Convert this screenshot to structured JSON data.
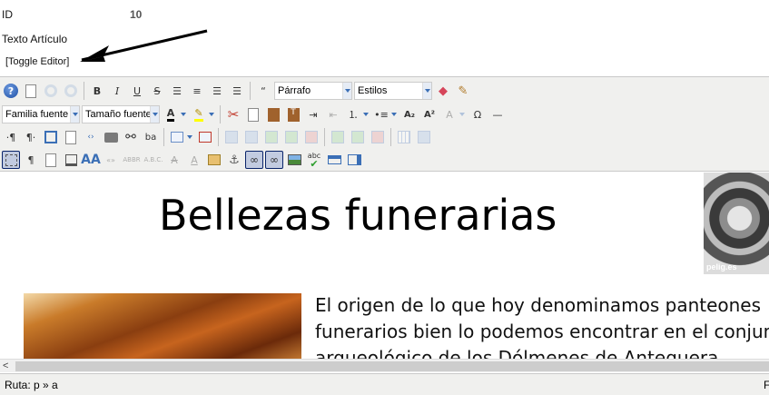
{
  "form": {
    "id_label": "ID",
    "id_value": "10",
    "text_label": "Texto Artículo",
    "toggle_editor": "[Toggle Editor]"
  },
  "toolbar": {
    "format_select": "Párrafo",
    "styles_select": "Estilos",
    "font_family_select": "Familia fuente",
    "font_size_select": "Tamaño fuente",
    "bold": "B",
    "italic": "I",
    "underline": "U",
    "strike": "S",
    "blockquote": "“",
    "subscript": "A₂",
    "superscript": "A²",
    "omega": "Ω",
    "abbr": "ABBR",
    "acronym": "A.B.C.",
    "cite": "«»",
    "spell": "abc"
  },
  "content": {
    "heading": "Bellezas funerarias",
    "image_watermark": "pelig.es",
    "paragraph_lines": [
      "El origen de lo que hoy denominamos panteones",
      "funerarios bien lo podemos encontrar en el conjun",
      "arqueológico de los Dólmenes de Antequera"
    ]
  },
  "status": {
    "path": "Ruta:  p » a",
    "right_char": "F"
  },
  "colors": {
    "toolbar_bg": "#f0f0ee",
    "selected_button_bg": "#c2cbe0"
  }
}
